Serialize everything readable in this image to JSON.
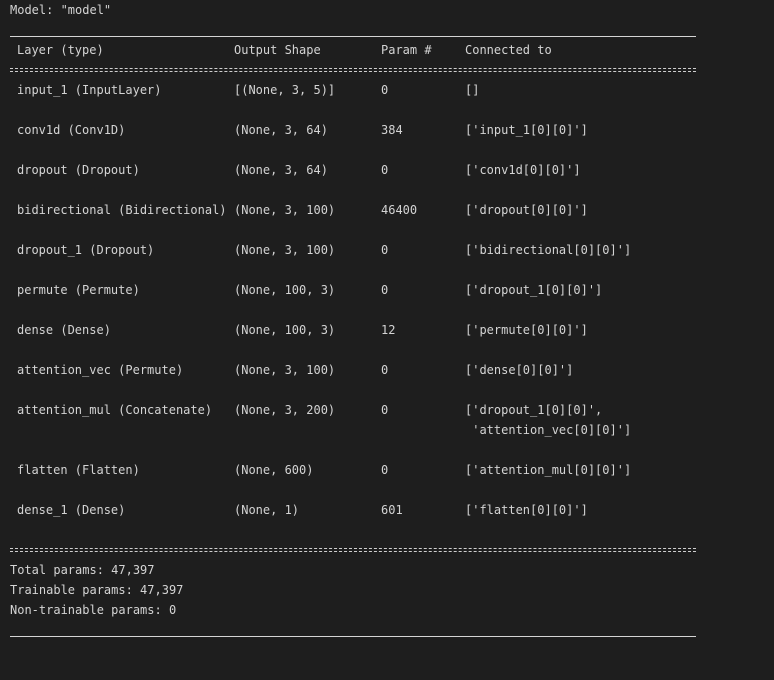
{
  "model_line": "Model: \"model\"",
  "headers": {
    "layer": "Layer (type)",
    "output_shape": "Output Shape",
    "params": "Param #",
    "connected": "Connected to"
  },
  "rows": [
    {
      "layer": "input_1 (InputLayer)",
      "shape": "[(None, 3, 5)]",
      "params": "0",
      "connected": "[]"
    },
    {
      "layer": "conv1d (Conv1D)",
      "shape": "(None, 3, 64)",
      "params": "384",
      "connected": "['input_1[0][0]']"
    },
    {
      "layer": "dropout (Dropout)",
      "shape": "(None, 3, 64)",
      "params": "0",
      "connected": "['conv1d[0][0]']"
    },
    {
      "layer": "bidirectional (Bidirectional)",
      "shape": "(None, 3, 100)",
      "params": "46400",
      "connected": "['dropout[0][0]']"
    },
    {
      "layer": "dropout_1 (Dropout)",
      "shape": "(None, 3, 100)",
      "params": "0",
      "connected": "['bidirectional[0][0]']"
    },
    {
      "layer": "permute (Permute)",
      "shape": "(None, 100, 3)",
      "params": "0",
      "connected": "['dropout_1[0][0]']"
    },
    {
      "layer": "dense (Dense)",
      "shape": "(None, 100, 3)",
      "params": "12",
      "connected": "['permute[0][0]']"
    },
    {
      "layer": "attention_vec (Permute)",
      "shape": "(None, 3, 100)",
      "params": "0",
      "connected": "['dense[0][0]']"
    },
    {
      "layer": "attention_mul (Concatenate)",
      "shape": "(None, 3, 200)",
      "params": "0",
      "connected": "['dropout_1[0][0]',",
      "connected_cont": " 'attention_vec[0][0]']"
    },
    {
      "layer": "flatten (Flatten)",
      "shape": "(None, 600)",
      "params": "0",
      "connected": "['attention_mul[0][0]']"
    },
    {
      "layer": "dense_1 (Dense)",
      "shape": "(None, 1)",
      "params": "601",
      "connected": "['flatten[0][0]']"
    }
  ],
  "totals": {
    "total": "Total params: 47,397",
    "trainable": "Trainable params: 47,397",
    "non_trainable": "Non-trainable params: 0"
  }
}
